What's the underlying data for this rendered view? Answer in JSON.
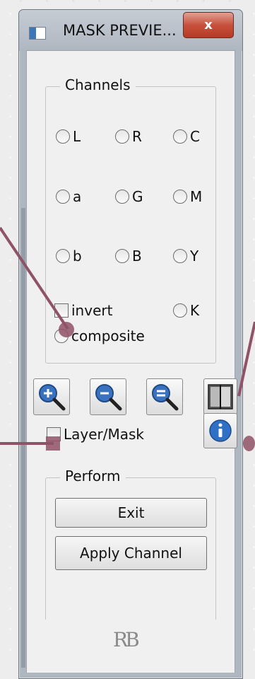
{
  "window": {
    "title": "MASK PREVIE...",
    "close_label": "x"
  },
  "channels": {
    "title": "Channels",
    "radios": [
      {
        "label": "L"
      },
      {
        "label": "R"
      },
      {
        "label": "C"
      },
      {
        "label": "a"
      },
      {
        "label": "G"
      },
      {
        "label": "M"
      },
      {
        "label": "b"
      },
      {
        "label": "B"
      },
      {
        "label": "Y"
      }
    ],
    "invert_label": "invert",
    "k_label": "K",
    "composite_label": "composite"
  },
  "tools": {
    "zoom_in_icon": "zoom-in-icon",
    "zoom_out_icon": "zoom-out-icon",
    "zoom_fit_icon": "zoom-fit-icon",
    "split_view_icon": "split-view-icon",
    "layer_mask_label": "Layer/Mask",
    "info_icon": "info-icon"
  },
  "perform": {
    "title": "Perform",
    "exit_label": "Exit",
    "apply_label": "Apply Channel"
  },
  "footer": {
    "logo_text": "RB"
  },
  "colors": {
    "annotation": "#8f5266",
    "close_button": "#c7513d",
    "info_blue": "#2f6fc4"
  }
}
